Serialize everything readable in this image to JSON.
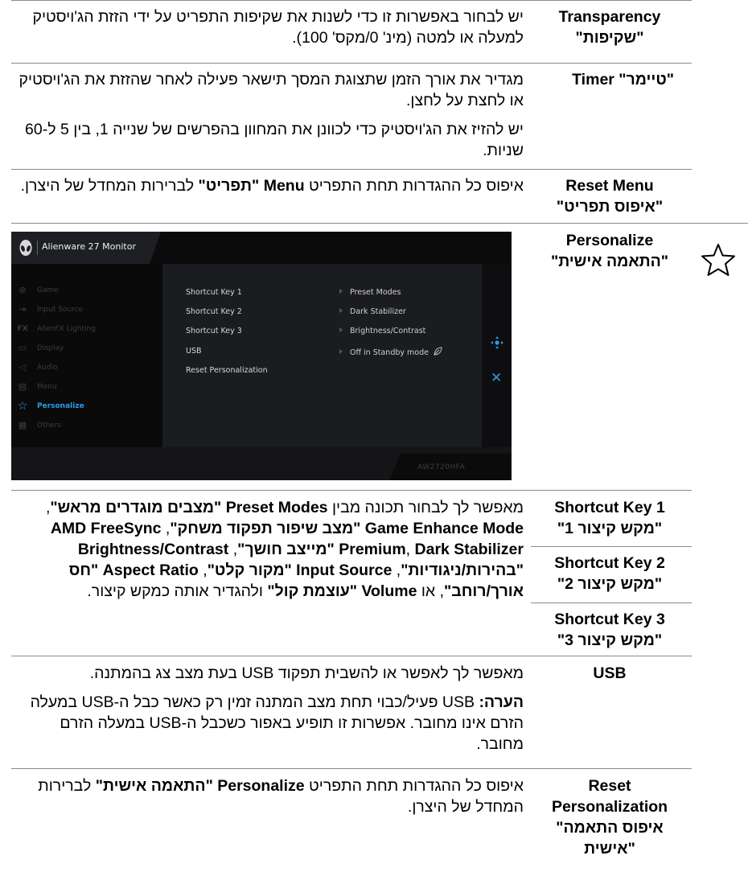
{
  "rows": {
    "transparency": {
      "label_en": "Transparency",
      "label_he": "\"שקיפות\"",
      "desc": "יש לבחור באפשרות זו כדי לשנות את שקיפות התפריט על ידי הזזת הג'ויסטיק למעלה או למטה (מינ' 0/מקס' 100)."
    },
    "timer": {
      "label": "Timer \"טיימר\"",
      "desc1": "מגדיר את אורך הזמן שתצוגת המסך תישאר פעילה לאחר שהזזת את הג'ויסטיק או לחצת על לחצן.",
      "desc2": "יש להזיז את הג'ויסטיק כדי לכוונן את המחוון בהפרשים של שנייה 1, בין 5 ל-60 שניות."
    },
    "reset_menu": {
      "label_en": "Reset Menu",
      "label_he": "\"איפוס תפריט\"",
      "desc_a": "איפוס כל ההגדרות תחת התפריט ",
      "desc_bold_en": "Menu",
      "desc_bold_he": " \"תפריט\"",
      "desc_b": " לברירות המחדל של היצרן."
    },
    "personalize": {
      "label_en": "Personalize",
      "label_he": "\"התאמה אישית\""
    },
    "shortcut1": {
      "label_en": "Shortcut Key 1",
      "label_he": "\"מקש קיצור 1\""
    },
    "shortcut2": {
      "label_en": "Shortcut Key 2",
      "label_he": "\"מקש קיצור 2\""
    },
    "shortcut3": {
      "label_en": "Shortcut Key 3",
      "label_he": "\"מקש קיצור 3\""
    },
    "shortcut_desc": {
      "t1": "מאפשר לך לבחור תכונה מבין ",
      "b1": "Preset Modes \"מצבים מוגדרים מראש\"",
      "t2": ", ",
      "b2": "Game Enhance Mode \"מצב שיפור תפקוד משחק\"",
      "t3": ", ",
      "b3": "AMD FreeSync Premium",
      "t4": ", ",
      "b4": "Dark Stabilizer \"מייצב חושך\"",
      "t5": ", ",
      "b5": "Brightness/Contrast \"בהירות/ניגודיות\"",
      "t6": ", ",
      "b6": "Input Source \"מקור קלט\"",
      "t7": ", ",
      "b7": "Aspect Ratio \"חס אורך/רוחב\"",
      "t8": ", או ",
      "b8": "Volume \"עוצמת קול\"",
      "t9": " ולהגדיר אותה כמקש קיצור."
    },
    "usb": {
      "label": "USB",
      "desc1": "מאפשר לך לאפשר או להשבית תפקוד USB בעת מצב צג בהמתנה.",
      "note_bold": "הערה:",
      "note_text": " USB פעיל/כבוי תחת מצב המתנה זמין רק כאשר כבל ה-USB במעלה הזרם אינו מחובר. אפשרות זו תופיע באפור כשכבל ה-USB במעלה הזרם מחובר."
    },
    "reset_personalization": {
      "label_en1": "Reset",
      "label_en2": "Personalization",
      "label_he1": "\"איפוס התאמה",
      "label_he2": "אישית\"",
      "desc_a": "איפוס כל ההגדרות תחת התפריט ",
      "desc_bold": "Personalize \"התאמה אישית\"",
      "desc_b": " לברירות המחדל של היצרן."
    }
  },
  "osd": {
    "title": "Alienware 27 Monitor",
    "model": "AW2720HFA",
    "menu": [
      {
        "icon": "gamepad-icon",
        "glyph": "⊛",
        "label": "Game"
      },
      {
        "icon": "input-source-icon",
        "glyph": "⇥",
        "label": "Input Source"
      },
      {
        "icon": "alienfx-icon",
        "glyph": "FX",
        "label": "AlienFX Lighting"
      },
      {
        "icon": "display-icon",
        "glyph": "▭",
        "label": "Display"
      },
      {
        "icon": "audio-icon",
        "glyph": "◁",
        "label": "Audio"
      },
      {
        "icon": "menu-icon",
        "glyph": "▤",
        "label": "Menu"
      },
      {
        "icon": "star-icon",
        "glyph": "☆",
        "label": "Personalize"
      },
      {
        "icon": "others-icon",
        "glyph": "▦",
        "label": "Others"
      }
    ],
    "options": [
      "Shortcut Key 1",
      "Shortcut Key 2",
      "Shortcut Key 3",
      "USB",
      "Reset Personalization"
    ],
    "values": [
      "Preset Modes",
      "Dark Stabilizer",
      "Brightness/Contrast",
      "Off in Standby mode"
    ],
    "accent": "#2c9be6"
  }
}
